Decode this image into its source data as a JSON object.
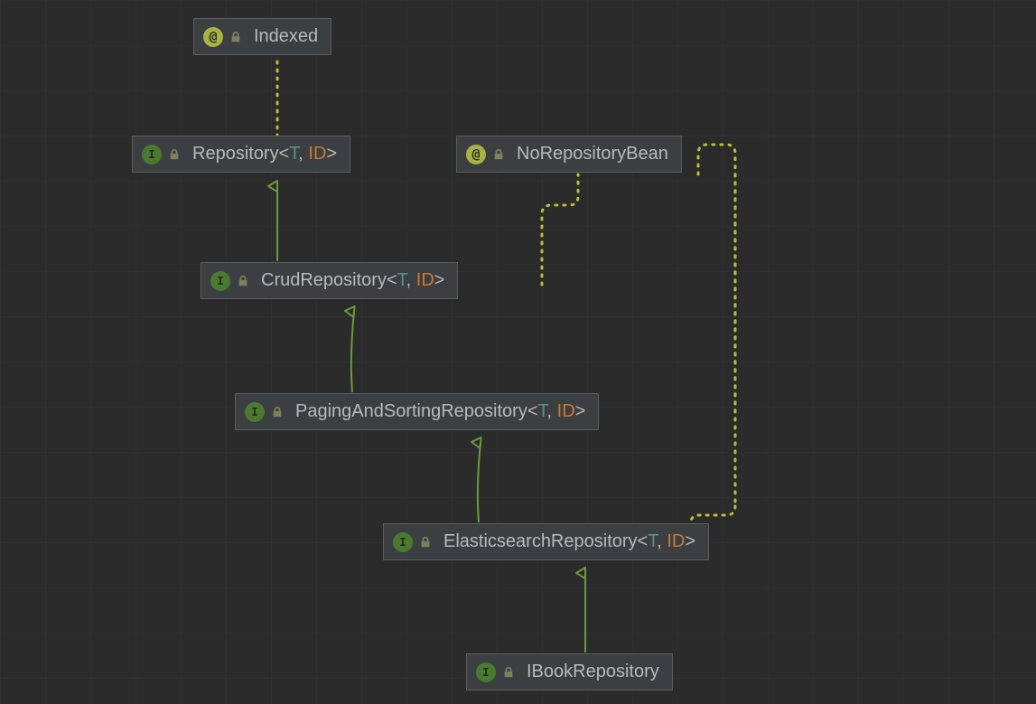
{
  "colors": {
    "background": "#2b2b2b",
    "node_bg": "#3c3f41",
    "node_border": "#5a5d5f",
    "text": "#b9b9b9",
    "type_param": "#5b8f8a",
    "type_param2": "#cc7832",
    "interface_badge": "#4a7a30",
    "annotation_badge": "#a9b244",
    "extends_line": "#6a9a3a",
    "annotation_line": "#bdbd3a"
  },
  "nodes": {
    "indexed": {
      "kind": "annotation",
      "name": "Indexed"
    },
    "repository": {
      "kind": "interface",
      "name": "Repository",
      "generics": [
        "T",
        "ID"
      ]
    },
    "norepo": {
      "kind": "annotation",
      "name": "NoRepositoryBean"
    },
    "crud": {
      "kind": "interface",
      "name": "CrudRepository",
      "generics": [
        "T",
        "ID"
      ]
    },
    "paging": {
      "kind": "interface",
      "name": "PagingAndSortingRepository",
      "generics": [
        "T",
        "ID"
      ]
    },
    "elastic": {
      "kind": "interface",
      "name": "ElasticsearchRepository",
      "generics": [
        "T",
        "ID"
      ]
    },
    "ibook": {
      "kind": "interface",
      "name": "IBookRepository"
    }
  },
  "edges": [
    {
      "from": "repository",
      "to": "indexed",
      "type": "annotation"
    },
    {
      "from": "crud",
      "to": "repository",
      "type": "extends"
    },
    {
      "from": "paging",
      "to": "crud",
      "type": "extends"
    },
    {
      "from": "elastic",
      "to": "paging",
      "type": "extends"
    },
    {
      "from": "ibook",
      "to": "elastic",
      "type": "extends"
    },
    {
      "from": "crud",
      "to": "norepo",
      "type": "annotation"
    },
    {
      "from": "paging",
      "to": "norepo",
      "type": "annotation"
    },
    {
      "from": "elastic",
      "to": "norepo",
      "type": "annotation"
    }
  ]
}
